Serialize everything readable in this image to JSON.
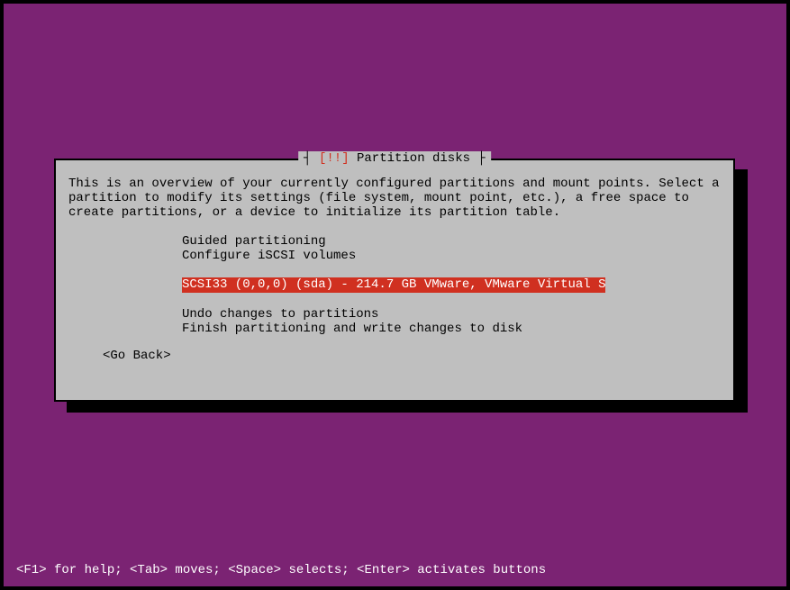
{
  "dialog": {
    "title_prefix": "┤ ",
    "title_marker": "[!!]",
    "title_text": " Partition disks",
    "title_suffix": " ├",
    "description": "This is an overview of your currently configured partitions and mount points. Select a partition to modify its settings (file system, mount point, etc.), a free space to create partitions, or a device to initialize its partition table.",
    "menu": {
      "guided": "Guided partitioning",
      "iscsi": "Configure iSCSI volumes",
      "disk": "SCSI33 (0,0,0) (sda) - 214.7 GB VMware, VMware Virtual S",
      "undo": "Undo changes to partitions",
      "finish": "Finish partitioning and write changes to disk"
    },
    "go_back": "<Go Back>"
  },
  "help_bar": "<F1> for help; <Tab> moves; <Space> selects; <Enter> activates buttons"
}
